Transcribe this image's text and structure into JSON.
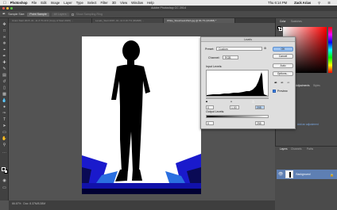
{
  "menubar": {
    "app_name": "Photoshop",
    "items": [
      "File",
      "Edit",
      "Image",
      "Layer",
      "Type",
      "Select",
      "Filter",
      "3D",
      "View",
      "Window",
      "Help"
    ],
    "clock": "Thu 6:14 PM",
    "user": "Zack Arias"
  },
  "window": {
    "title": "Adobe Photoshop CC 2014"
  },
  "options": {
    "sample_size_label": "Sample Size:",
    "sample_size_value": "Point Sample",
    "sample_value": "All Layers",
    "show_ring_label": "Show Sampling Ring"
  },
  "tabs": [
    {
      "label": "Union Start 2015 -01 -11 # 70.21% (Copy of Start 2015) ...",
      "active": false
    },
    {
      "label": "Levels_Start 2015 -01 -11 # 16.7% (RGB/8) ...",
      "active": false
    },
    {
      "label": "White_Stretches1152A.jpg @ 66.7% (RGB/8) *",
      "active": true
    }
  ],
  "status": {
    "zoom": "66.67%",
    "doc": "Doc: 8.37M/8.38M"
  },
  "panels": {
    "color_tabs": [
      "Color",
      "Swatches"
    ],
    "adjust_tabs": [
      "Adjustments",
      "Styles"
    ],
    "layers_tabs": [
      "Layers",
      "Channels",
      "Paths"
    ],
    "layer_name": "Background",
    "side_link": "Add an adjustment"
  },
  "levels": {
    "title": "Levels",
    "preset_label": "Preset:",
    "preset_value": "Custom",
    "channel_label": "Channel:",
    "channel_value": "RGB",
    "input_levels_label": "Input Levels:",
    "input_black": "0",
    "input_mid": "1.00",
    "input_white": "205",
    "output_levels_label": "Output Levels:",
    "output_black": "0",
    "output_white": "255",
    "ok": "OK",
    "cancel": "Cancel",
    "auto": "Auto",
    "options": "Options...",
    "preview_label": "Preview",
    "preview_checked": true
  },
  "colors": {
    "menubar": "#e9e9e9",
    "ui_dark": "#535353",
    "selection": "#5e7fb3",
    "ok_button": "#9bc2f0"
  },
  "icons": [
    "apple-icon",
    "eyedropper-icon",
    "move-icon",
    "marquee-icon",
    "lasso-icon",
    "crop-icon",
    "brush-icon",
    "eraser-icon",
    "gradient-icon",
    "type-icon",
    "hand-icon",
    "zoom-icon",
    "eye-icon",
    "lock-icon"
  ]
}
